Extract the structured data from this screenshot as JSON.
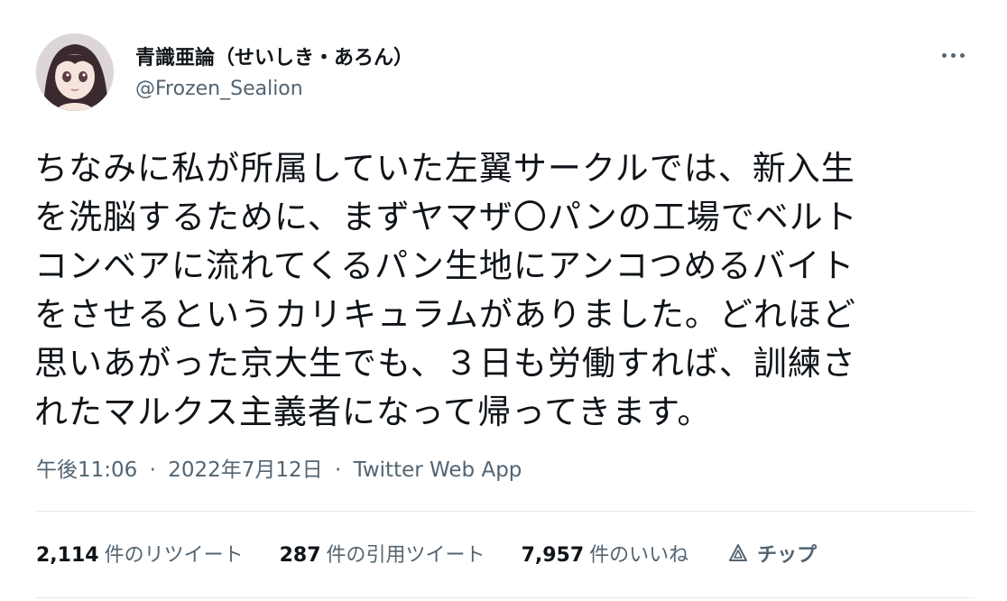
{
  "author": {
    "display_name": "青識亜論（せいしき・あろん）",
    "handle": "@Frozen_Sealion"
  },
  "tweet": {
    "lines": [
      "ちなみに私が所属していた左翼サークルでは、新入生",
      "を洗脳するために、まずヤマザ〇パンの工場でベルト",
      "コンベアに流れてくるパン生地にアンコつめるバイト",
      "をさせるというカリキュラムがありました。どれほど",
      "思いあがった京大生でも、３日も労働すれば、訓練さ",
      "れたマルクス主義者になって帰ってきます。"
    ]
  },
  "meta": {
    "time": "午後11:06",
    "separator": "·",
    "date": "2022年7月12日",
    "source": "Twitter Web App"
  },
  "stats": {
    "retweets": {
      "count": "2,114",
      "label": "件のリツイート"
    },
    "quotes": {
      "count": "287",
      "label": "件の引用ツイート"
    },
    "likes": {
      "count": "7,957",
      "label": "件のいいね"
    },
    "tip_label": "チップ"
  },
  "icons": {
    "more": "more-options-icon",
    "tip": "tip-icon"
  },
  "colors": {
    "text": "#0f1419",
    "secondary": "#536471",
    "divider": "#e4e7ea"
  }
}
